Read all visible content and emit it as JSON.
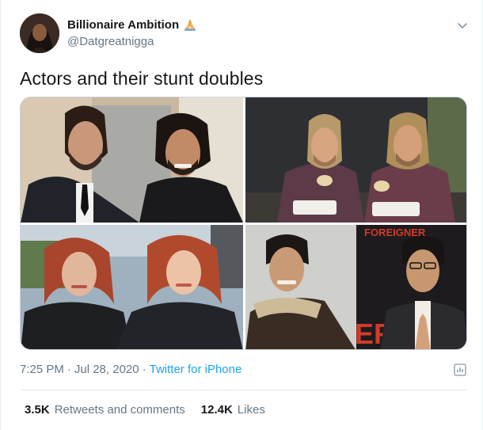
{
  "author": {
    "display_name": "Billionaire Ambition",
    "handle": "@Datgreatnigga"
  },
  "tweet": {
    "text": "Actors and their stunt doubles"
  },
  "meta": {
    "time": "7:25 PM",
    "separator1": "·",
    "date": "Jul 28, 2020",
    "separator2": "·",
    "source": "Twitter for iPhone"
  },
  "stats": {
    "retweets_count": "3.5K",
    "retweets_label": "Retweets and comments",
    "likes_count": "12.4K",
    "likes_label": "Likes"
  },
  "media": {
    "sign_text_top": "FOREIGNER",
    "sign_text_side": "ER"
  },
  "colors": {
    "link": "#1da1f2",
    "secondary_text": "#657786",
    "primary_text": "#14171a"
  },
  "icons": {
    "menu": "chevron-down-icon",
    "analytics": "analytics-icon",
    "emoji": "pray-icon"
  }
}
